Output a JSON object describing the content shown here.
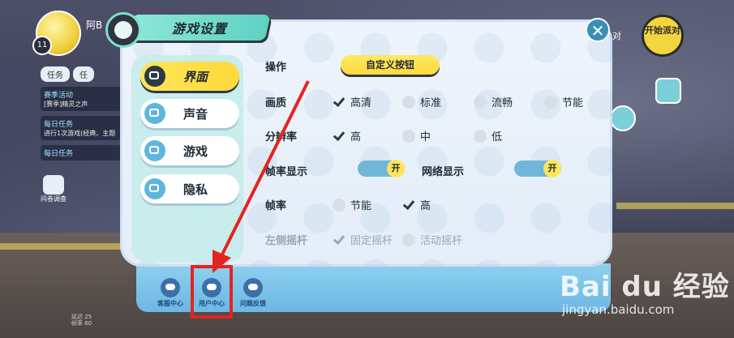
{
  "hud": {
    "player_name": "阿B",
    "level": "11",
    "task_tabs": [
      "任务",
      "任"
    ],
    "tasks": [
      {
        "title": "赛季活动",
        "desc": "[赛季]精灵之声"
      },
      {
        "title": "每日任务",
        "desc": "进行1次游戏(经典、主题"
      },
      {
        "title": "每日任务",
        "desc": ""
      }
    ],
    "survey_label": "问卷调查",
    "start_button": "开始派对",
    "pair_text": "对",
    "stats_lines": [
      "延迟 25",
      "帧率 60"
    ]
  },
  "dialog": {
    "title": "游戏设置",
    "close_icon": "close-icon",
    "tabs": [
      {
        "label": "界面",
        "active": true,
        "icon": "monitor-icon"
      },
      {
        "label": "声音",
        "active": false,
        "icon": "monitor-icon"
      },
      {
        "label": "游戏",
        "active": false,
        "icon": "monitor-icon"
      },
      {
        "label": "隐私",
        "active": false,
        "icon": "monitor-icon"
      }
    ],
    "settings": {
      "operation": {
        "label": "操作",
        "button": "自定义按钮"
      },
      "quality": {
        "label": "画质",
        "options": [
          "高清",
          "标准",
          "流畅",
          "节能"
        ],
        "selected": 0
      },
      "resolution": {
        "label": "分辨率",
        "options": [
          "高",
          "中",
          "低"
        ],
        "selected": 0
      },
      "fps_display": {
        "label": "帧率显示",
        "toggle_text": "开"
      },
      "network_display": {
        "label": "网络显示",
        "toggle_text": "开"
      },
      "fps": {
        "label": "帧率",
        "options": [
          "节能",
          "高"
        ],
        "selected": 1
      },
      "left_joystick": {
        "label": "左侧摇杆",
        "options": [
          "固定摇杆",
          "活动摇杆"
        ],
        "selected": 0
      }
    },
    "tray": [
      {
        "label": "客服中心",
        "icon": "headset-icon"
      },
      {
        "label": "用户中心",
        "icon": "user-robot-icon"
      },
      {
        "label": "问题反馈",
        "icon": "feedback-icon"
      }
    ]
  },
  "watermark": {
    "logo": "Bai du 经验",
    "url": "jingyan.baidu.com"
  },
  "colors": {
    "accent_yellow": "#ffd93a",
    "teal": "#5fd0c2",
    "highlight_red": "#e5241f",
    "tab_blue": "#5fb6dd"
  }
}
